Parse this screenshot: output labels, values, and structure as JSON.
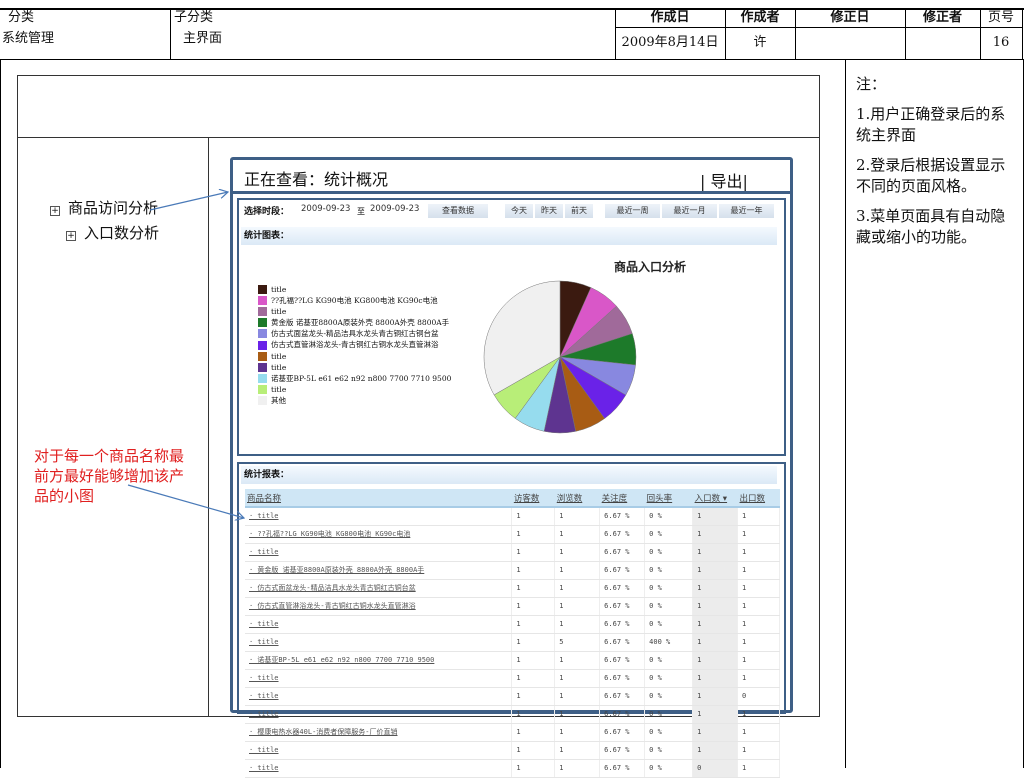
{
  "header": {
    "category_label": "分类",
    "category": "系统管理",
    "subcategory_label": "子分类",
    "subcategory": "主界面",
    "created_date_label": "作成日",
    "created_date": "2009年8月14日",
    "author_label": "作成者",
    "author": "许",
    "modified_date_label": "修正日",
    "modifier_label": "修正者",
    "page_label": "页号",
    "page": "16"
  },
  "notes": {
    "title": "注：",
    "items": [
      "1.用户正确登录后的系统主界面",
      "2.登录后根据设置显示不同的页面风格。",
      "3.菜单页面具有自动隐藏或缩小的功能。"
    ]
  },
  "nav": {
    "items": [
      "商品访问分析",
      "入口数分析"
    ]
  },
  "annotation": "对于每一个商品名称最前方最好能够增加该产品的小图",
  "screen": {
    "viewing": "正在查看：统计概况",
    "export": "| 导出|",
    "period_label": "选择时段：",
    "date_from": "2009-09-23",
    "to": "至",
    "date_to": "2009-09-23",
    "view_btn": "查看数据",
    "quick": [
      "今天",
      "昨天",
      "前天"
    ],
    "ranges": [
      "最近一周",
      "最近一月",
      "最近一年"
    ],
    "chart_section": "统计图表：",
    "report_section": "统计报表："
  },
  "chart_data": {
    "type": "pie",
    "title": "商品入口分析",
    "labels": [
      "title",
      "??孔福??LG KG90电池 KG800电池 KG90c电池",
      "title",
      "黄金版 诺基亚8800A原装外壳 8800A外壳 8800A手",
      "仿古式面盆龙头-精品洁具水龙头青古铜红古铜台盆",
      "仿古式直管淋浴龙头-青古铜红古铜水龙头直管淋浴",
      "title",
      "title",
      "诺基亚BP-5L e61 e62 n92 n800 7700 7710 9500",
      "title",
      "其他"
    ],
    "values": [
      6.67,
      6.67,
      6.67,
      6.67,
      6.67,
      6.67,
      6.67,
      6.67,
      6.67,
      6.67,
      33.3
    ],
    "colors": [
      "#3b1a10",
      "#d957c8",
      "#a06a9a",
      "#1d7a2a",
      "#8888e0",
      "#6a22e8",
      "#a85c14",
      "#5e3490",
      "#96dcee",
      "#b8ee78",
      "#f0f0f0"
    ]
  },
  "table": {
    "columns": [
      "商品名称",
      "访客数",
      "浏览数",
      "关注度",
      "回头率",
      "入口数 ▾",
      "出口数"
    ],
    "rows": [
      [
        "· title",
        "1",
        "1",
        "6.67 %",
        "0 %",
        "1",
        "1"
      ],
      [
        "· ??孔福??LG KG90电池 KG800电池 KG90c电池",
        "1",
        "1",
        "6.67 %",
        "0 %",
        "1",
        "1"
      ],
      [
        "· title",
        "1",
        "1",
        "6.67 %",
        "0 %",
        "1",
        "1"
      ],
      [
        "· 黄金版 诺基亚8800A原装外壳 8800A外壳 8800A手",
        "1",
        "1",
        "6.67 %",
        "0 %",
        "1",
        "1"
      ],
      [
        "· 仿古式面盆龙头-精品洁具水龙头青古铜红古铜台盆",
        "1",
        "1",
        "6.67 %",
        "0 %",
        "1",
        "1"
      ],
      [
        "· 仿古式直管淋浴龙头-青古铜红古铜水龙头直管淋浴",
        "1",
        "1",
        "6.67 %",
        "0 %",
        "1",
        "1"
      ],
      [
        "· title",
        "1",
        "1",
        "6.67 %",
        "0 %",
        "1",
        "1"
      ],
      [
        "· title",
        "1",
        "5",
        "6.67 %",
        "400 %",
        "1",
        "1"
      ],
      [
        "· 诺基亚BP-5L e61 e62 n92 n800 7700 7710 9500",
        "1",
        "1",
        "6.67 %",
        "0 %",
        "1",
        "1"
      ],
      [
        "· title",
        "1",
        "1",
        "6.67 %",
        "0 %",
        "1",
        "1"
      ],
      [
        "· title",
        "1",
        "1",
        "6.67 %",
        "0 %",
        "1",
        "0"
      ],
      [
        "· title",
        "1",
        "1",
        "6.67 %",
        "0 %",
        "1",
        "1"
      ],
      [
        "· 樱康电热水器40L-消费者保障服务-厂价直销",
        "1",
        "1",
        "6.67 %",
        "0 %",
        "1",
        "1"
      ],
      [
        "· title",
        "1",
        "1",
        "6.67 %",
        "0 %",
        "1",
        "1"
      ],
      [
        "· title",
        "1",
        "1",
        "6.67 %",
        "0 %",
        "0",
        "1"
      ]
    ]
  }
}
